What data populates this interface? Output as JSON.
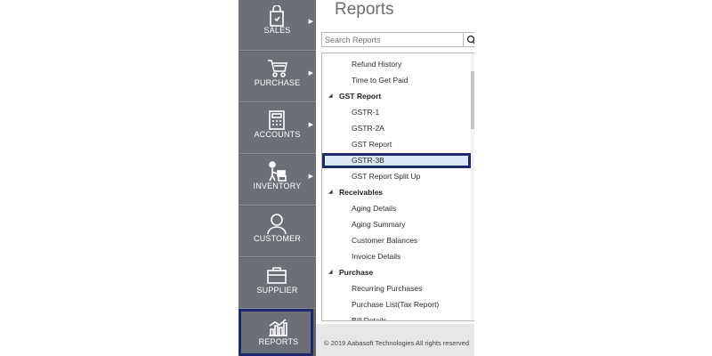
{
  "sidebar": {
    "items": [
      {
        "label": "SALES",
        "icon": "shopping-bag-icon"
      },
      {
        "label": "PURCHASE",
        "icon": "cart-icon"
      },
      {
        "label": "ACCOUNTS",
        "icon": "calculator-icon"
      },
      {
        "label": "INVENTORY",
        "icon": "worker-boxes-icon"
      },
      {
        "label": "CUSTOMER",
        "icon": "person-icon"
      },
      {
        "label": "SUPPLIER",
        "icon": "briefcase-icon"
      },
      {
        "label": "REPORTS",
        "icon": "bar-chart-icon",
        "active": true
      }
    ]
  },
  "main": {
    "title": "Reports",
    "search": {
      "placeholder": "Search Reports"
    },
    "tree": [
      {
        "type": "child",
        "label": "Refund History"
      },
      {
        "type": "child",
        "label": "Time to Get Paid"
      },
      {
        "type": "group",
        "label": "GST Report"
      },
      {
        "type": "child",
        "label": "GSTR-1"
      },
      {
        "type": "child",
        "label": "GSTR-2A"
      },
      {
        "type": "child",
        "label": "GST Report"
      },
      {
        "type": "child",
        "label": "GSTR-3B",
        "selected": true
      },
      {
        "type": "child",
        "label": "GST Report Split Up"
      },
      {
        "type": "group",
        "label": "Receivables"
      },
      {
        "type": "child",
        "label": "Aging Details"
      },
      {
        "type": "child",
        "label": "Aging Summary"
      },
      {
        "type": "child",
        "label": "Customer Balances"
      },
      {
        "type": "child",
        "label": "Invoice Details"
      },
      {
        "type": "group",
        "label": "Purchase"
      },
      {
        "type": "child",
        "label": "Recurring Purchases"
      },
      {
        "type": "child",
        "label": "Purchase List(Tax Report)"
      },
      {
        "type": "child",
        "label": "Bill Details"
      }
    ],
    "footer": "© 2019 Aabasoft Technologies All rights reserved"
  },
  "colors": {
    "sidebar": "#6b7076",
    "highlight_border": "#1f2a6e",
    "selection_fill": "#dbe8f6"
  }
}
